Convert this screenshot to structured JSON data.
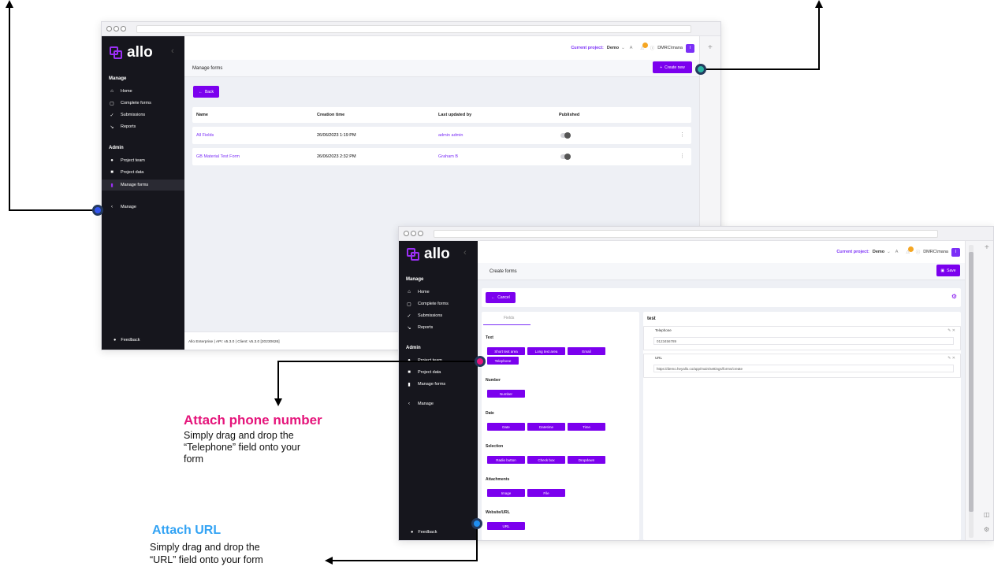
{
  "brand": "allo",
  "colors": {
    "accent": "#7b00ee",
    "sidebar": "#16161d",
    "pink_title": "#e5157b",
    "blue_title": "#33a3f4",
    "marker_phone": "#e5157b",
    "marker_url": "#1f8ef1",
    "marker_teal": "#2bb3a3",
    "marker_blue": "#3355ee"
  },
  "window1": {
    "topbar": {
      "project_label": "Current project:",
      "project_name": "Demo",
      "user": "DMRC\\mana",
      "avatar_text": "I"
    },
    "page_title": "Manage forms",
    "create_button": "Create new",
    "back_button": "Back",
    "sidebar": {
      "manage_title": "Manage",
      "manage_items": [
        "Home",
        "Complete forms",
        "Submissions",
        "Reports"
      ],
      "admin_title": "Admin",
      "admin_items": [
        "Project team",
        "Project data",
        "Manage forms"
      ],
      "collapse_item": "Manage",
      "feedback": "Feedback"
    },
    "table": {
      "headers": [
        "Name",
        "Creation time",
        "Last updated by",
        "Published"
      ],
      "rows": [
        {
          "name": "All Fields",
          "created": "26/06/2023 1:19 PM",
          "updated_by": "admin admin"
        },
        {
          "name": "GB Material Test Form",
          "created": "26/06/2023 2:32 PM",
          "updated_by": "Graham B"
        }
      ]
    },
    "footer": "Allo Enterprise | API: v5.3.0 | Client: v5.3.0 [20230626]"
  },
  "window2": {
    "topbar": {
      "project_label": "Current project:",
      "project_name": "Demo",
      "user": "DMRC\\mana",
      "avatar_text": "I"
    },
    "page_title": "Create forms",
    "save_button": "Save",
    "cancel_button": "Cancel",
    "sidebar": {
      "manage_title": "Manage",
      "manage_items": [
        "Home",
        "Complete forms",
        "Submissions",
        "Reports"
      ],
      "admin_title": "Admin",
      "admin_items": [
        "Project team",
        "Project data",
        "Manage forms"
      ],
      "collapse_item": "Manage",
      "feedback": "Feedback"
    },
    "fields_tab": "Fields",
    "groups": {
      "text": {
        "title": "Text",
        "items": [
          "Short text area",
          "Long text area",
          "Email",
          "Telephone"
        ]
      },
      "number": {
        "title": "Number",
        "items": [
          "Number"
        ]
      },
      "date": {
        "title": "Date",
        "items": [
          "Date",
          "Datetime",
          "Time"
        ]
      },
      "selection": {
        "title": "Selection",
        "items": [
          "Radio button",
          "Check box",
          "Dropdown"
        ]
      },
      "attachments": {
        "title": "Attachments",
        "items": [
          "Image",
          "File"
        ]
      },
      "website": {
        "title": "Website/URL",
        "items": [
          "URL"
        ]
      }
    },
    "form": {
      "title": "test",
      "fields": [
        {
          "label": "Telephone",
          "value": "0123456789"
        },
        {
          "label": "URL",
          "value": "https://demo.heyallo.co/app/main/settings/forms/create"
        }
      ]
    }
  },
  "callouts": {
    "phone_title": "Attach phone number",
    "phone_line1": "Simply drag and drop the",
    "phone_line2": "“Telephone” field onto your",
    "phone_line3": "form",
    "url_title": "Attach URL",
    "url_line1": "Simply drag and drop the",
    "url_line2": "“URL” field onto your form"
  }
}
